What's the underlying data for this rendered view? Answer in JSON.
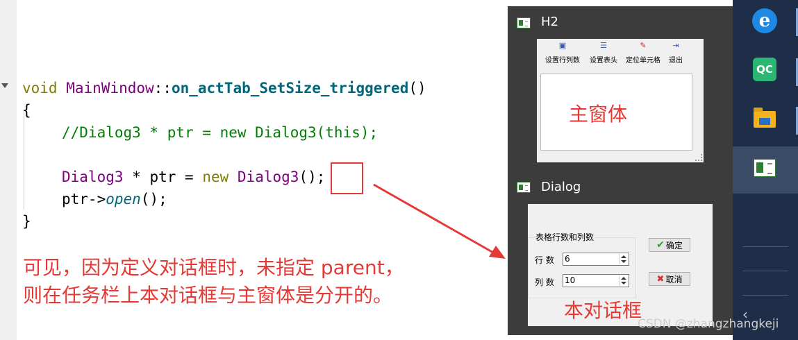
{
  "code": {
    "line1": {
      "kw": "void",
      "cls": "MainWindow",
      "sep": "::",
      "fn": "on_actTab_SetSize_triggered",
      "tail": "()"
    },
    "line2": "{",
    "line3": "//Dialog3 * ptr = new Dialog3(this);",
    "line4": {
      "cls": "Dialog3",
      "mid": " * ptr = ",
      "kw": "new",
      "cls2": "Dialog3",
      "tail": "();"
    },
    "line5": {
      "head": "ptr->",
      "it": "open",
      "tail": "();"
    },
    "line6": "}"
  },
  "annotation": {
    "line1": "可见，因为定义对话框时，未指定 parent，",
    "line2": "则在任务栏上本对话框与主窗体是分开的。"
  },
  "preview_main": {
    "title": "H2",
    "toolbar": [
      "设置行列数",
      "设置表头",
      "定位单元格",
      "退出"
    ],
    "caption": "主窗体"
  },
  "preview_dialog": {
    "title": "Dialog",
    "group_title": "表格行数和列数",
    "rows_label": "行 数",
    "rows_value": "6",
    "cols_label": "列 数",
    "cols_value": "10",
    "ok_label": "确定",
    "cancel_label": "取消",
    "caption": "本对话框"
  },
  "taskbar": {
    "qc_label": "QC"
  },
  "watermark": "CSDN @zhangzhangkeji",
  "colors": {
    "annotation_red": "#e53935",
    "preview_bg": "#3c3c3c",
    "taskbar_bg": "#1e2e48"
  }
}
